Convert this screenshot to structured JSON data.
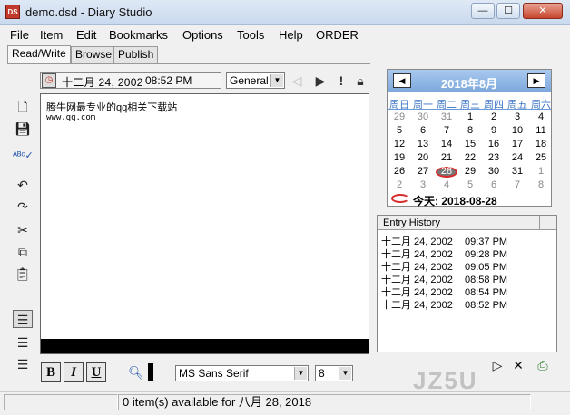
{
  "window": {
    "title": "demo.dsd - Diary Studio",
    "app_icon": "DS"
  },
  "window_controls": {
    "minimize": "—",
    "maximize": "☐",
    "close": "✕"
  },
  "menu": [
    "File",
    "Item",
    "Edit",
    "Bookmarks",
    "Options",
    "Tools",
    "Help",
    "ORDER"
  ],
  "tabs": [
    "Read/Write",
    "Browse",
    "Publish"
  ],
  "entry_bar": {
    "date": "十二月 24, 2002",
    "time": "08:52 PM",
    "category": "General"
  },
  "editor": {
    "line1": "腾牛网最专业的qq相关下载站",
    "line2": "www.qq.com"
  },
  "format": {
    "bold": "B",
    "italic": "I",
    "underline": "U",
    "font": "MS Sans Serif",
    "size": "8"
  },
  "calendar": {
    "title": "2018年8月",
    "weekdays": [
      "周日",
      "周一",
      "周二",
      "周三",
      "周四",
      "周五",
      "周六"
    ],
    "weeks": [
      [
        "29",
        "30",
        "31",
        "1",
        "2",
        "3",
        "4"
      ],
      [
        "5",
        "6",
        "7",
        "8",
        "9",
        "10",
        "11"
      ],
      [
        "12",
        "13",
        "14",
        "15",
        "16",
        "17",
        "18"
      ],
      [
        "19",
        "20",
        "21",
        "22",
        "23",
        "24",
        "25"
      ],
      [
        "26",
        "27",
        "28",
        "29",
        "30",
        "31",
        "1"
      ],
      [
        "2",
        "3",
        "4",
        "5",
        "6",
        "7",
        "8"
      ]
    ],
    "today_label": "今天: 2018-08-28",
    "today_day": "28"
  },
  "history": {
    "header": "Entry History",
    "rows": [
      {
        "date": "十二月 24, 2002",
        "time": "09:37 PM"
      },
      {
        "date": "十二月 24, 2002",
        "time": "09:28 PM"
      },
      {
        "date": "十二月 24, 2002",
        "time": "09:05 PM"
      },
      {
        "date": "十二月 24, 2002",
        "time": "08:58 PM"
      },
      {
        "date": "十二月 24, 2002",
        "time": "08:54 PM"
      },
      {
        "date": "十二月 24, 2002",
        "time": "08:52 PM"
      }
    ]
  },
  "status": {
    "text": "0 item(s) available for 八月 28, 2018"
  },
  "watermark": "JZ5U"
}
